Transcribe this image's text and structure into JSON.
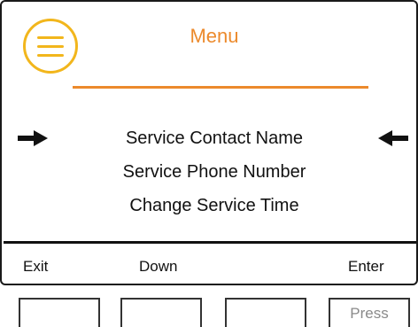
{
  "header": {
    "title": "Menu",
    "menu_icon": "hamburger-menu-icon",
    "accent_color": "#ec8a2c",
    "icon_color": "#f2b61c"
  },
  "menu": {
    "items": [
      {
        "label": "Service Contact Name",
        "selected": true
      },
      {
        "label": "Service Phone Number",
        "selected": false
      },
      {
        "label": "Change Service Time",
        "selected": false
      }
    ],
    "selection_indicator_icons": [
      "arrow-right-icon",
      "arrow-left-icon"
    ]
  },
  "softkeys": {
    "exit": "Exit",
    "down": "Down",
    "enter": "Enter"
  },
  "hardware_buttons": {
    "button4_label": "Press"
  }
}
